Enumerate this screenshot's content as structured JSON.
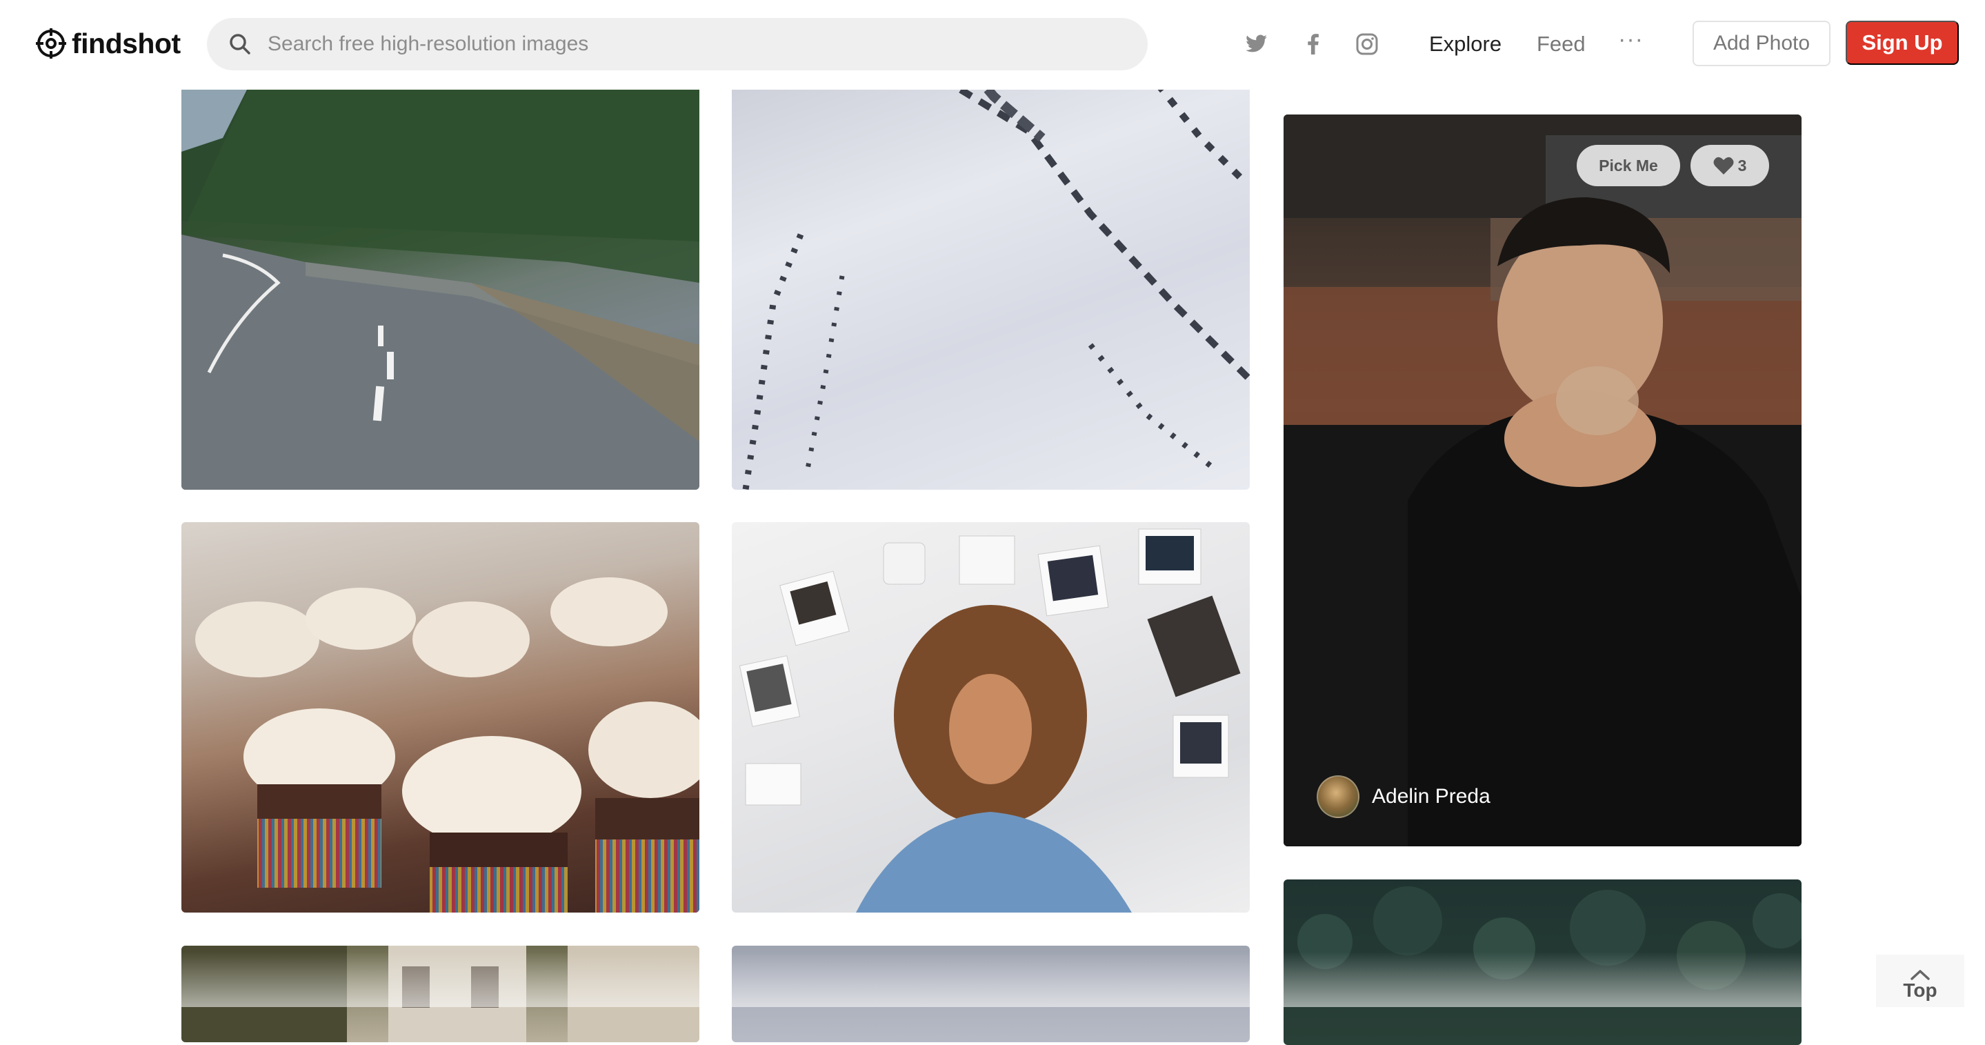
{
  "app": {
    "name": "findshot"
  },
  "search": {
    "placeholder": "Search free high-resolution images",
    "value": ""
  },
  "header": {
    "social": [
      "twitter-icon",
      "facebook-icon",
      "instagram-icon"
    ],
    "nav": {
      "explore": "Explore",
      "feed": "Feed",
      "more": "···"
    },
    "add_photo": "Add Photo",
    "sign_up": "Sign Up"
  },
  "colors": {
    "brand_red": "#e0372b",
    "search_bg": "#efefef",
    "text_dark": "#111111"
  },
  "featured": {
    "pick_label": "Pick Me",
    "likes": "3",
    "author": "Adelin Preda"
  },
  "photos": [
    {
      "subject": "road-through-pine-forest"
    },
    {
      "subject": "snowy-mountain-slope"
    },
    {
      "subject": "cupcakes-with-frosting"
    },
    {
      "subject": "woman-covering-face-with-polaroids"
    },
    {
      "subject": "man-drinking-coffee"
    },
    {
      "subject": "street-buildings"
    },
    {
      "subject": "grey-sky"
    },
    {
      "subject": "dark-forest-canopy"
    }
  ],
  "scroll_top": {
    "label": "Top"
  }
}
